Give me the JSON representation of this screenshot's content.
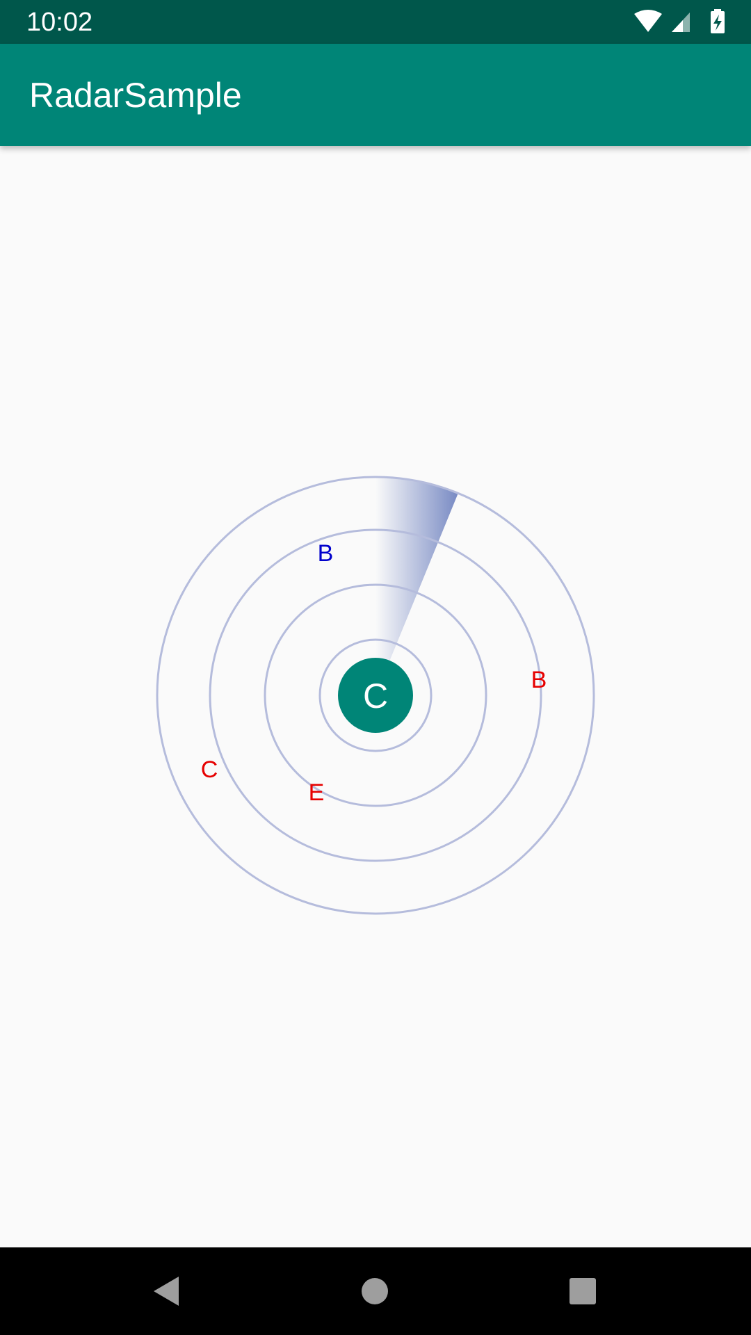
{
  "status_bar": {
    "time": "10:02",
    "icons": [
      "wifi-icon",
      "cell-signal-icon",
      "battery-charging-icon"
    ]
  },
  "app_bar": {
    "title": "RadarSample"
  },
  "radar": {
    "center_label": "C",
    "colors": {
      "ring": "#b5bcdc",
      "sweep": "#7083c0",
      "center": "#008577",
      "center_text": "#ffffff",
      "blue_label": "#0000cc",
      "red_label": "#e60000"
    },
    "labels": [
      {
        "text": "B",
        "color": "blue"
      },
      {
        "text": "B",
        "color": "red"
      },
      {
        "text": "C",
        "color": "red"
      },
      {
        "text": "E",
        "color": "red"
      }
    ]
  },
  "nav_bar": {
    "items": [
      "back-icon",
      "home-icon",
      "recents-icon"
    ]
  }
}
